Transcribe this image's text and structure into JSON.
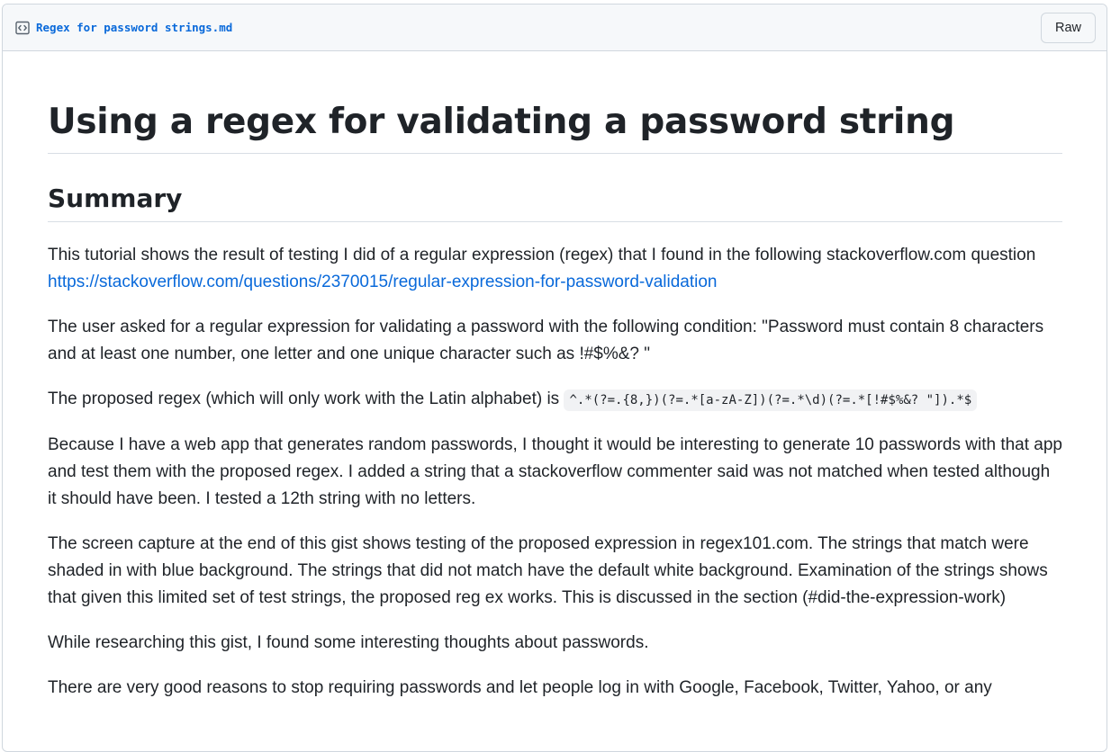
{
  "file": {
    "name": "Regex for password strings.md",
    "raw_label": "Raw"
  },
  "icons": {
    "file_icon": "code-file-icon"
  },
  "content": {
    "title": "Using a regex for validating a password string",
    "summary_heading": "Summary",
    "p1_text": "This tutorial shows the result of testing I did of a regular expression (regex) that I found in the following stackoverflow.com question ",
    "p1_link": "https://stackoverflow.com/questions/2370015/regular-expression-for-password-validation",
    "p2": "The user asked for a regular expression for validating a password with the following condition: \"Password must contain 8 characters and at least one number, one letter and one unique character such as !#$%&? \"",
    "p3_text": "The proposed regex (which will only work with the Latin alphabet) is ",
    "p3_code": "^.*(?=.{8,})(?=.*[a-zA-Z])(?=.*\\d)(?=.*[!#$%&? \"]).*$",
    "p4": "Because I have a web app that generates random passwords, I thought it would be interesting to generate 10 passwords with that app and test them with the proposed regex. I added a string that a stackoverflow commenter said was not matched when tested although it should have been. I tested a 12th string with no letters.",
    "p5": "The screen capture at the end of this gist shows testing of the proposed expression in regex101.com. The strings that match were shaded in with blue background. The strings that did not match have the default white background. Examination of the strings shows that given this limited set of test strings, the proposed reg ex works. This is discussed in the section (#did-the-expression-work)",
    "p6": "While researching this gist, I found some interesting thoughts about passwords.",
    "p7": "There are very good reasons to stop requiring passwords and let people log in with Google, Facebook, Twitter, Yahoo, or any"
  },
  "colors": {
    "link": "#0969da",
    "header_bg": "#f6f8fa",
    "border": "#d0d7de",
    "text": "#1f2328"
  }
}
